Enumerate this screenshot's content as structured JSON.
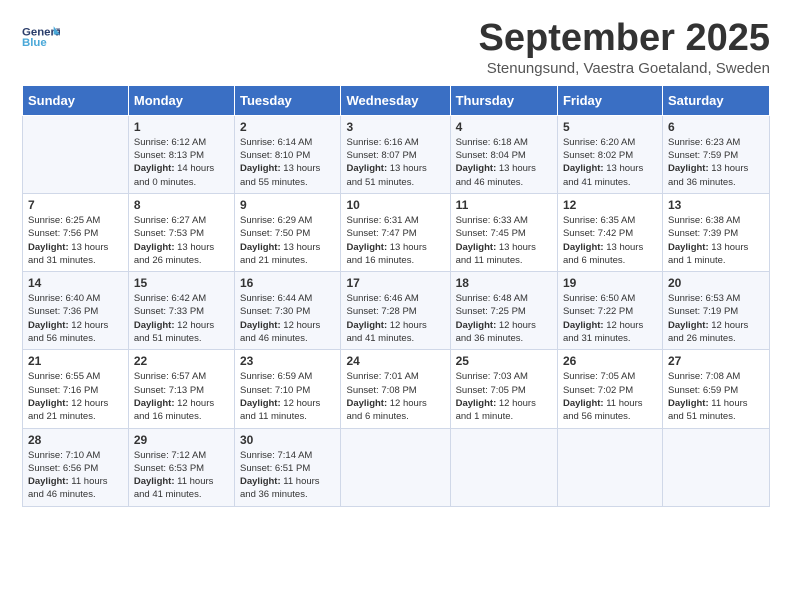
{
  "logo": {
    "line1": "General",
    "line2_color": "Blue",
    "tagline": ""
  },
  "header": {
    "month": "September 2025",
    "location": "Stenungsund, Vaestra Goetaland, Sweden"
  },
  "weekdays": [
    "Sunday",
    "Monday",
    "Tuesday",
    "Wednesday",
    "Thursday",
    "Friday",
    "Saturday"
  ],
  "weeks": [
    [
      {
        "day": "",
        "sunrise": "",
        "sunset": "",
        "daylight": ""
      },
      {
        "day": "1",
        "sunrise": "Sunrise: 6:12 AM",
        "sunset": "Sunset: 8:13 PM",
        "daylight": "Daylight: 14 hours and 0 minutes."
      },
      {
        "day": "2",
        "sunrise": "Sunrise: 6:14 AM",
        "sunset": "Sunset: 8:10 PM",
        "daylight": "Daylight: 13 hours and 55 minutes."
      },
      {
        "day": "3",
        "sunrise": "Sunrise: 6:16 AM",
        "sunset": "Sunset: 8:07 PM",
        "daylight": "Daylight: 13 hours and 51 minutes."
      },
      {
        "day": "4",
        "sunrise": "Sunrise: 6:18 AM",
        "sunset": "Sunset: 8:04 PM",
        "daylight": "Daylight: 13 hours and 46 minutes."
      },
      {
        "day": "5",
        "sunrise": "Sunrise: 6:20 AM",
        "sunset": "Sunset: 8:02 PM",
        "daylight": "Daylight: 13 hours and 41 minutes."
      },
      {
        "day": "6",
        "sunrise": "Sunrise: 6:23 AM",
        "sunset": "Sunset: 7:59 PM",
        "daylight": "Daylight: 13 hours and 36 minutes."
      }
    ],
    [
      {
        "day": "7",
        "sunrise": "Sunrise: 6:25 AM",
        "sunset": "Sunset: 7:56 PM",
        "daylight": "Daylight: 13 hours and 31 minutes."
      },
      {
        "day": "8",
        "sunrise": "Sunrise: 6:27 AM",
        "sunset": "Sunset: 7:53 PM",
        "daylight": "Daylight: 13 hours and 26 minutes."
      },
      {
        "day": "9",
        "sunrise": "Sunrise: 6:29 AM",
        "sunset": "Sunset: 7:50 PM",
        "daylight": "Daylight: 13 hours and 21 minutes."
      },
      {
        "day": "10",
        "sunrise": "Sunrise: 6:31 AM",
        "sunset": "Sunset: 7:47 PM",
        "daylight": "Daylight: 13 hours and 16 minutes."
      },
      {
        "day": "11",
        "sunrise": "Sunrise: 6:33 AM",
        "sunset": "Sunset: 7:45 PM",
        "daylight": "Daylight: 13 hours and 11 minutes."
      },
      {
        "day": "12",
        "sunrise": "Sunrise: 6:35 AM",
        "sunset": "Sunset: 7:42 PM",
        "daylight": "Daylight: 13 hours and 6 minutes."
      },
      {
        "day": "13",
        "sunrise": "Sunrise: 6:38 AM",
        "sunset": "Sunset: 7:39 PM",
        "daylight": "Daylight: 13 hours and 1 minute."
      }
    ],
    [
      {
        "day": "14",
        "sunrise": "Sunrise: 6:40 AM",
        "sunset": "Sunset: 7:36 PM",
        "daylight": "Daylight: 12 hours and 56 minutes."
      },
      {
        "day": "15",
        "sunrise": "Sunrise: 6:42 AM",
        "sunset": "Sunset: 7:33 PM",
        "daylight": "Daylight: 12 hours and 51 minutes."
      },
      {
        "day": "16",
        "sunrise": "Sunrise: 6:44 AM",
        "sunset": "Sunset: 7:30 PM",
        "daylight": "Daylight: 12 hours and 46 minutes."
      },
      {
        "day": "17",
        "sunrise": "Sunrise: 6:46 AM",
        "sunset": "Sunset: 7:28 PM",
        "daylight": "Daylight: 12 hours and 41 minutes."
      },
      {
        "day": "18",
        "sunrise": "Sunrise: 6:48 AM",
        "sunset": "Sunset: 7:25 PM",
        "daylight": "Daylight: 12 hours and 36 minutes."
      },
      {
        "day": "19",
        "sunrise": "Sunrise: 6:50 AM",
        "sunset": "Sunset: 7:22 PM",
        "daylight": "Daylight: 12 hours and 31 minutes."
      },
      {
        "day": "20",
        "sunrise": "Sunrise: 6:53 AM",
        "sunset": "Sunset: 7:19 PM",
        "daylight": "Daylight: 12 hours and 26 minutes."
      }
    ],
    [
      {
        "day": "21",
        "sunrise": "Sunrise: 6:55 AM",
        "sunset": "Sunset: 7:16 PM",
        "daylight": "Daylight: 12 hours and 21 minutes."
      },
      {
        "day": "22",
        "sunrise": "Sunrise: 6:57 AM",
        "sunset": "Sunset: 7:13 PM",
        "daylight": "Daylight: 12 hours and 16 minutes."
      },
      {
        "day": "23",
        "sunrise": "Sunrise: 6:59 AM",
        "sunset": "Sunset: 7:10 PM",
        "daylight": "Daylight: 12 hours and 11 minutes."
      },
      {
        "day": "24",
        "sunrise": "Sunrise: 7:01 AM",
        "sunset": "Sunset: 7:08 PM",
        "daylight": "Daylight: 12 hours and 6 minutes."
      },
      {
        "day": "25",
        "sunrise": "Sunrise: 7:03 AM",
        "sunset": "Sunset: 7:05 PM",
        "daylight": "Daylight: 12 hours and 1 minute."
      },
      {
        "day": "26",
        "sunrise": "Sunrise: 7:05 AM",
        "sunset": "Sunset: 7:02 PM",
        "daylight": "Daylight: 11 hours and 56 minutes."
      },
      {
        "day": "27",
        "sunrise": "Sunrise: 7:08 AM",
        "sunset": "Sunset: 6:59 PM",
        "daylight": "Daylight: 11 hours and 51 minutes."
      }
    ],
    [
      {
        "day": "28",
        "sunrise": "Sunrise: 7:10 AM",
        "sunset": "Sunset: 6:56 PM",
        "daylight": "Daylight: 11 hours and 46 minutes."
      },
      {
        "day": "29",
        "sunrise": "Sunrise: 7:12 AM",
        "sunset": "Sunset: 6:53 PM",
        "daylight": "Daylight: 11 hours and 41 minutes."
      },
      {
        "day": "30",
        "sunrise": "Sunrise: 7:14 AM",
        "sunset": "Sunset: 6:51 PM",
        "daylight": "Daylight: 11 hours and 36 minutes."
      },
      {
        "day": "",
        "sunrise": "",
        "sunset": "",
        "daylight": ""
      },
      {
        "day": "",
        "sunrise": "",
        "sunset": "",
        "daylight": ""
      },
      {
        "day": "",
        "sunrise": "",
        "sunset": "",
        "daylight": ""
      },
      {
        "day": "",
        "sunrise": "",
        "sunset": "",
        "daylight": ""
      }
    ]
  ]
}
